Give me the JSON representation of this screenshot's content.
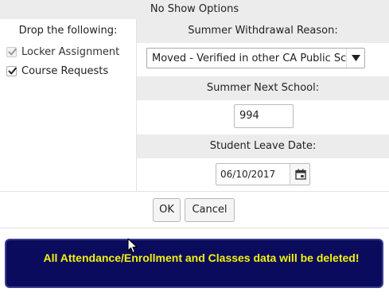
{
  "dialog": {
    "title": "No Show Options"
  },
  "drop_section": {
    "heading": "Drop the following:",
    "items": [
      {
        "label": "Locker Assignment",
        "checked": true,
        "disabled": true
      },
      {
        "label": "Course Requests",
        "checked": true,
        "disabled": false
      }
    ]
  },
  "withdrawal": {
    "heading": "Summer Withdrawal Reason:",
    "selected": "Moved - Verified in other CA Public School"
  },
  "next_school": {
    "heading": "Summer Next School:",
    "value": "994"
  },
  "leave_date": {
    "heading": "Student Leave Date:",
    "value": "06/10/2017"
  },
  "buttons": {
    "ok": "OK",
    "cancel": "Cancel"
  },
  "warning": {
    "text": "All Attendance/Enrollment and Classes data will be deleted!",
    "text_color": "#f3f30a",
    "background": "#0b0b5e"
  }
}
